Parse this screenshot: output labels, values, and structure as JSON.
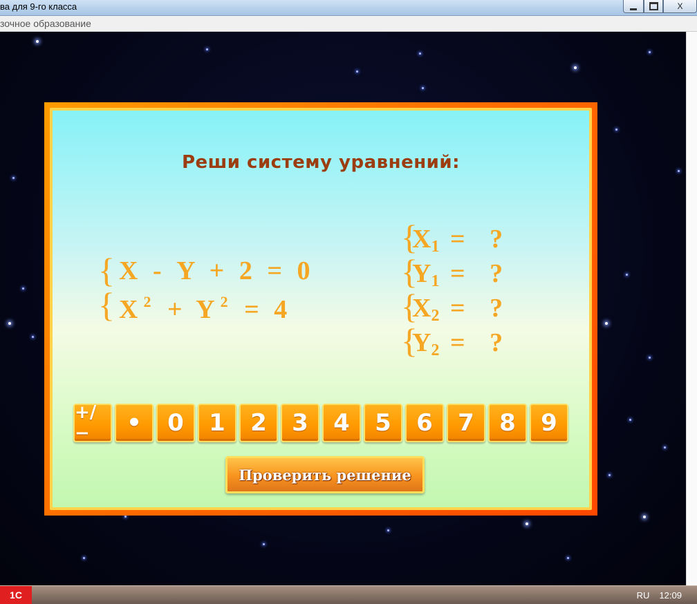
{
  "window": {
    "title": "ва для 9-го класса",
    "subtitle": "зочное образование",
    "minimize": "minimize",
    "maximize": "maximize",
    "close_label": "X"
  },
  "game": {
    "heading": "Реши систему уравнений:",
    "equation1": [
      "X",
      "-",
      "Y",
      "+",
      "2",
      "=",
      "0"
    ],
    "equation2": {
      "x": "X",
      "x_exp": "2",
      "plus": "+",
      "y": "Y",
      "y_exp": "2",
      "eq": "=",
      "rhs": "4"
    },
    "answers": [
      {
        "var": "X",
        "idx": "1",
        "eq": "=",
        "value": "?"
      },
      {
        "var": "Y",
        "idx": "1",
        "eq": "=",
        "value": "?"
      },
      {
        "var": "X",
        "idx": "2",
        "eq": "=",
        "value": "?"
      },
      {
        "var": "Y",
        "idx": "2",
        "eq": "=",
        "value": "?"
      }
    ],
    "keys": [
      "+/−",
      "•",
      "0",
      "1",
      "2",
      "3",
      "4",
      "5",
      "6",
      "7",
      "8",
      "9"
    ],
    "check_button": "Проверить решение",
    "colors": {
      "accent": "#f5a623",
      "heading": "#9b3d10",
      "frame": "#ff6a00"
    }
  },
  "taskbar": {
    "start": "1С",
    "lang": "RU",
    "time": "12:09"
  }
}
